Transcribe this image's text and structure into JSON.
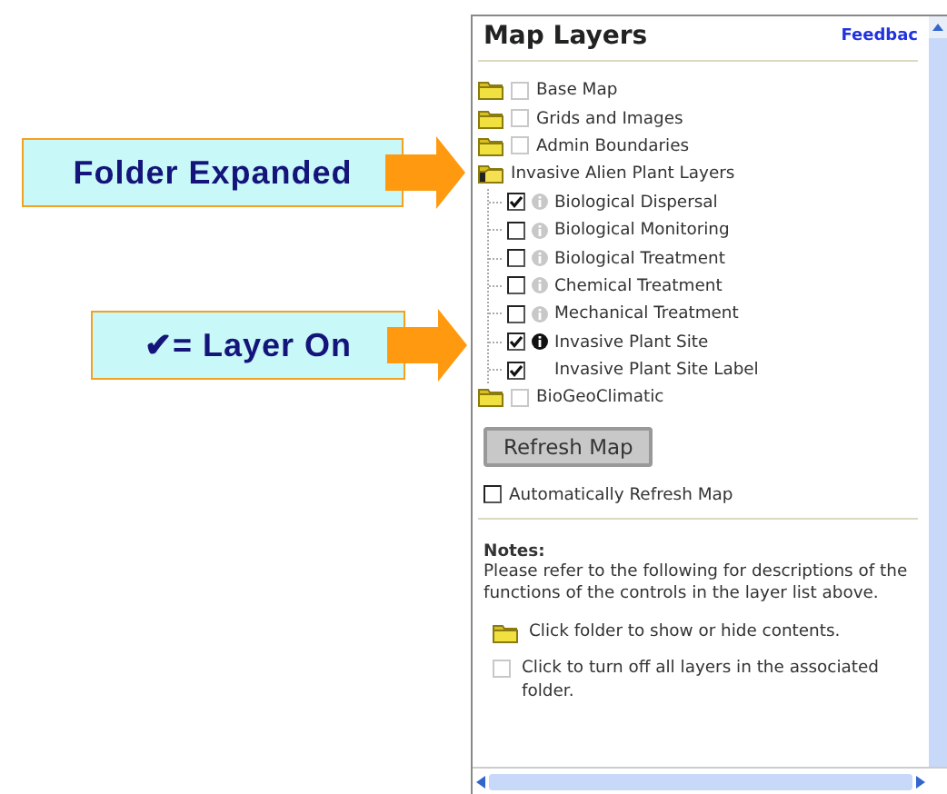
{
  "callouts": [
    {
      "text": "Folder Expanded"
    },
    {
      "text": "✔= Layer On"
    }
  ],
  "panel": {
    "title": "Map Layers",
    "feedback_link": "Feedbac",
    "layers": [
      {
        "label": "Base Map",
        "expanded": false,
        "checked": false,
        "disabled": true
      },
      {
        "label": "Grids and Images",
        "expanded": false,
        "checked": false,
        "disabled": true
      },
      {
        "label": "Admin Boundaries",
        "expanded": false,
        "checked": false,
        "disabled": true
      },
      {
        "label": "Invasive Alien Plant Layers",
        "expanded": true,
        "children": [
          {
            "kind": "layer",
            "label": "Biological Dispersal",
            "checked": true,
            "info_enabled": false
          },
          {
            "kind": "layer",
            "label": "Biological Monitoring",
            "checked": false,
            "info_enabled": false
          },
          {
            "kind": "layer",
            "label": "Biological Treatment",
            "checked": false,
            "info_enabled": false
          },
          {
            "kind": "layer",
            "label": "Chemical Treatment",
            "checked": false,
            "info_enabled": false
          },
          {
            "kind": "layer",
            "label": "Mechanical Treatment",
            "checked": false,
            "info_enabled": false
          },
          {
            "kind": "layer",
            "label": "Invasive Plant Site",
            "checked": true,
            "info_enabled": true
          },
          {
            "kind": "label",
            "label": "Invasive Plant Site Label",
            "checked": true
          }
        ]
      },
      {
        "label": "BioGeoClimatic",
        "expanded": false,
        "checked": false,
        "disabled": true
      }
    ],
    "refresh_button": "Refresh Map",
    "auto_refresh": {
      "label": "Automatically Refresh Map",
      "checked": false
    },
    "notes": {
      "heading": "Notes:",
      "text": "Please refer to the following for descriptions of the functions of the controls in the layer list above.",
      "items": [
        {
          "kind": "folder",
          "text": "Click folder to show or hide contents."
        },
        {
          "kind": "checkbox",
          "text": "Click to turn off all layers in the associated folder."
        }
      ]
    }
  }
}
